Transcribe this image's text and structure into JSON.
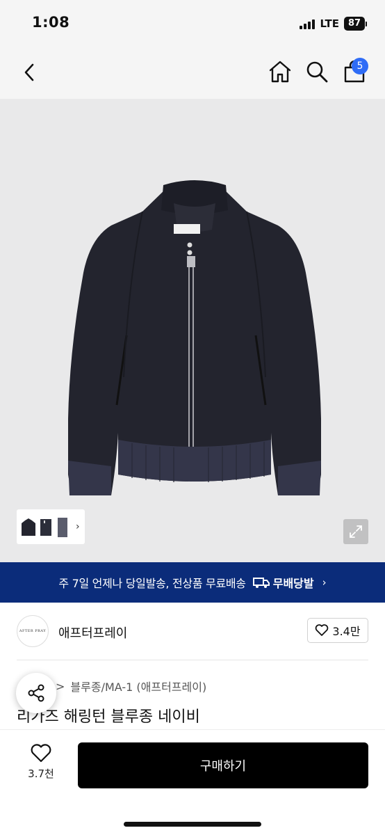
{
  "status_bar": {
    "time": "1:08",
    "network": "LTE",
    "battery": "87"
  },
  "nav": {
    "back_icon": "chevron-left-icon",
    "home_icon": "home-icon",
    "search_icon": "search-icon",
    "cart_icon": "shopping-bag-icon",
    "cart_badge": "5"
  },
  "gallery": {
    "expand_icon": "expand-icon",
    "thumb_chevron": "›"
  },
  "shipping_banner": {
    "text": "주 7일 언제나 당일발송, 전상품 무료배송",
    "brand_label": "무배당발",
    "chevron": "›",
    "bg_color": "#0b2c7a"
  },
  "shop": {
    "logo_text": "AFTER PRAY",
    "name": "애프터프레이",
    "like_count": "3.4만"
  },
  "product": {
    "breadcrumb": [
      ">",
      "블루종/MA-1 (애프터프레이)"
    ],
    "title": "리가즈 해링턴 블루종 네이비"
  },
  "bottom_bar": {
    "wish_count": "3.7천",
    "buy_label": "구매하기"
  }
}
